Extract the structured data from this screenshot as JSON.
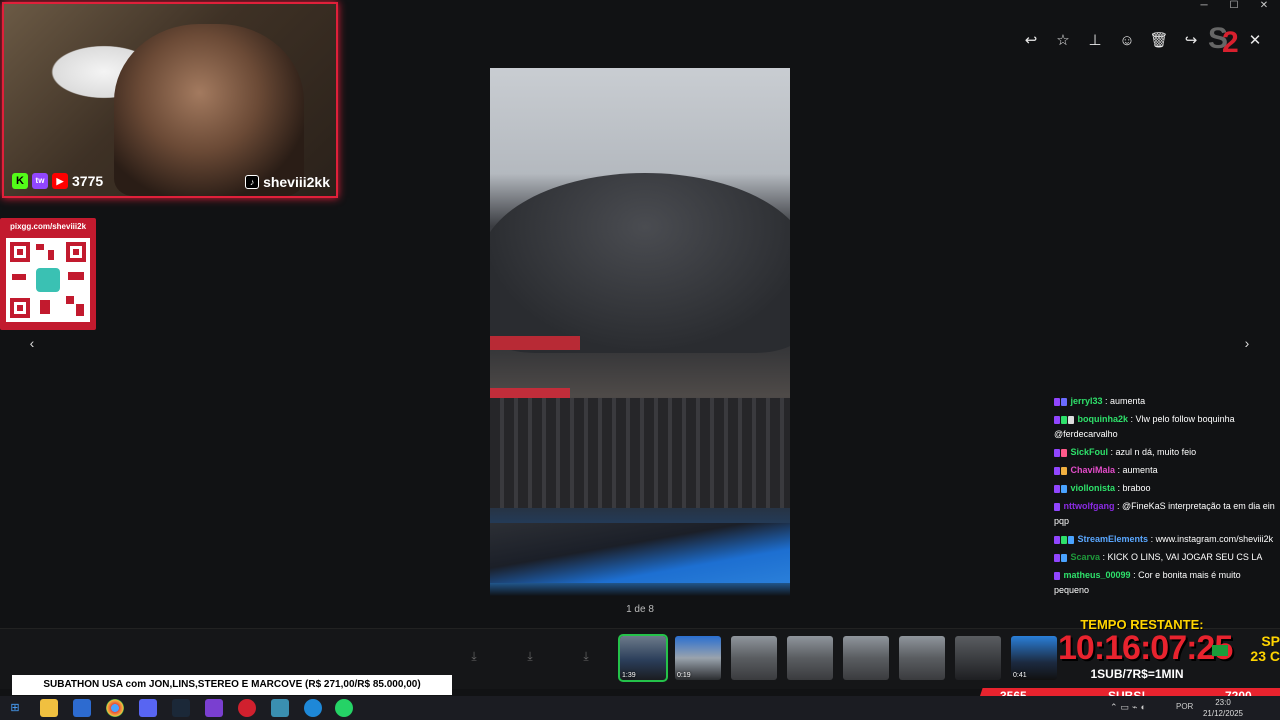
{
  "window": {
    "minimize": "─",
    "maximize": "☐",
    "close": "✕"
  },
  "toolbar": {
    "reply": "↩",
    "star": "☆",
    "pin": "⊥",
    "emoji": "☺",
    "trash": "🗑",
    "forward": "↪",
    "close": "✕"
  },
  "webcam": {
    "viewer_count": "3775",
    "handle": "sheviii2kk",
    "platform_badges": [
      "K",
      "tw",
      "▶"
    ]
  },
  "qr": {
    "url": "pixgg.com/sheviii2k"
  },
  "viewer": {
    "page_counter": "1 de 8",
    "prev_arrow": "‹",
    "next_arrow": "›"
  },
  "filmstrip": {
    "thumbs": [
      {
        "duration": "1:39"
      },
      {
        "duration": "0:19"
      },
      {
        "duration": ""
      },
      {
        "duration": ""
      },
      {
        "duration": ""
      },
      {
        "duration": ""
      },
      {
        "duration": ""
      },
      {
        "duration": "0:41"
      }
    ],
    "download_icon": "⤓"
  },
  "chat": [
    {
      "user": "jerryl33",
      "color": "#2ee06a",
      "text": " : aumenta"
    },
    {
      "user": "boquinha2k",
      "color": "#2ee06a",
      "text": " : Vlw pelo follow boquinha @ferdecarvalho"
    },
    {
      "user": "SickFoul",
      "color": "#2ee06a",
      "text": " : azul n dá, muito feio"
    },
    {
      "user": "ChaviMala",
      "color": "#e34cc9",
      "text": " : aumenta"
    },
    {
      "user": "viollonista",
      "color": "#2ee06a",
      "text": " : braboo"
    },
    {
      "user": "nttwolfgang",
      "color": "#8a2be2",
      "text": " : @FineKaS interpretação ta em dia ein pqp"
    },
    {
      "user": "StreamElements",
      "color": "#5aa7ff",
      "text": " : www.instagram.com/sheviii2k"
    },
    {
      "user": "Scarva",
      "color": "#1e9b3b",
      "text": " : KICK O LINS, VAI JOGAR SEU CS LA"
    },
    {
      "user": "matheus_00099",
      "color": "#2ee06a",
      "text": " : Cor e bonita mais é muito pequeno"
    }
  ],
  "timer": {
    "title": "TEMPO RESTANTE:",
    "value": "10:16:07:25",
    "rate": "1SUB/7R$=1MIN",
    "city": "SP",
    "temp": "23 C"
  },
  "subs": {
    "left_count": "3565",
    "label": "SUBS!",
    "right_count": "7200"
  },
  "ticker": {
    "text": "SUBATHON USA com JON,LINS,STEREO E MARCOVE (R$ 271,00/R$ 85.000,00)"
  },
  "taskbar": {
    "lang": "POR",
    "time": "23:0",
    "date": "21/12/2025"
  },
  "colors": {
    "accent_red": "#e8232e",
    "timer_yellow": "#ffd400",
    "active_green": "#24c24a"
  }
}
